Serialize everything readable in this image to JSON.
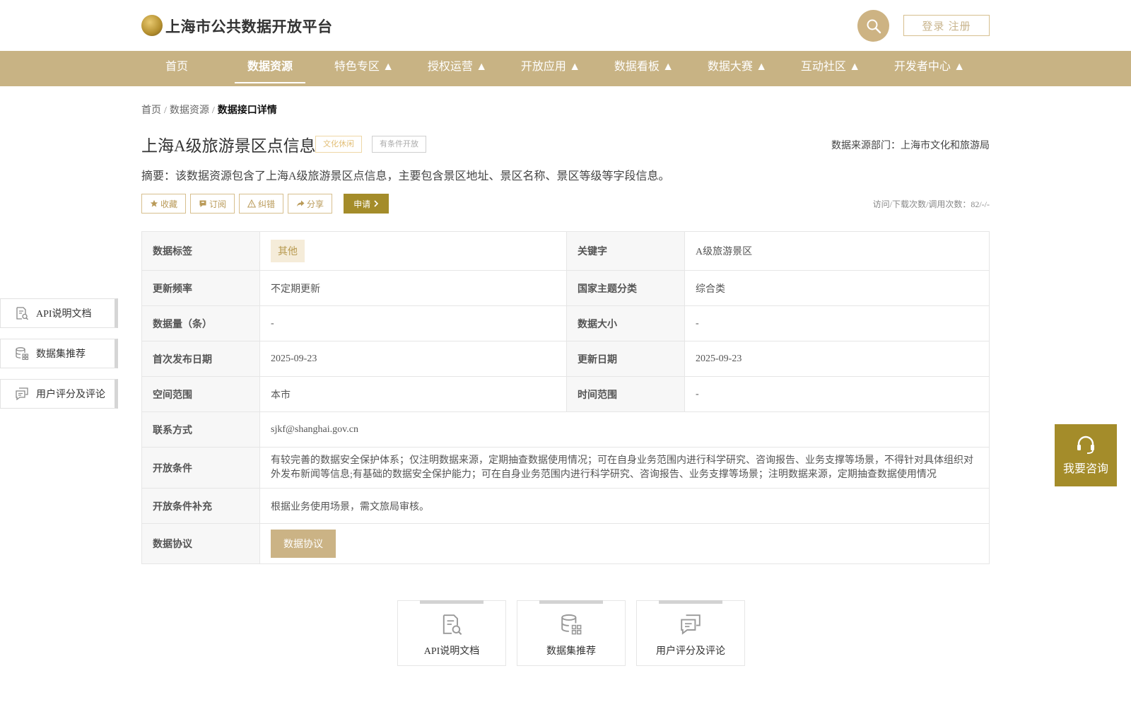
{
  "header": {
    "site_title": "上海市公共数据开放平台",
    "login_label": "登录 注册",
    "logo_icon": "city-seal-logo",
    "search_icon": "search-icon"
  },
  "nav": {
    "items": [
      {
        "label": "首页"
      },
      {
        "label": "数据资源",
        "active": true
      },
      {
        "label": "特色专区 ▲"
      },
      {
        "label": "授权运营 ▲"
      },
      {
        "label": "开放应用 ▲"
      },
      {
        "label": "数据看板 ▲"
      },
      {
        "label": "数据大赛 ▲"
      },
      {
        "label": "互动社区 ▲"
      },
      {
        "label": "开发者中心 ▲"
      }
    ]
  },
  "breadcrumb": {
    "items": [
      "首页",
      "数据资源"
    ],
    "separator": "/",
    "current": "数据接口详情"
  },
  "dataset": {
    "title": "上海A级旅游景区点信息",
    "tags": [
      "文化休闲",
      "有条件开放"
    ],
    "dept": "数据来源部门：上海市文化和旅游局",
    "summary": "摘要：该数据资源包含了上海A级旅游景区点信息，主要包含景区地址、景区名称、景区等级等字段信息。",
    "stats": "访问/下载次数/调用次数：82/-/-"
  },
  "actions": {
    "favorite": "收藏",
    "subscribe": "订阅",
    "report": "纠错",
    "share": "分享",
    "apply": "申请"
  },
  "table": {
    "data_tag_label": "数据标签",
    "data_tag_value": "其他",
    "keyword_label": "关键字",
    "keyword_value": "A级旅游景区",
    "update_freq_label": "更新频率",
    "update_freq_value": "不定期更新",
    "theme_label": "国家主题分类",
    "theme_value": "综合类",
    "count_label": "数据量（条）",
    "count_value": "-",
    "size_label": "数据大小",
    "size_value": "-",
    "first_pub_label": "首次发布日期",
    "first_pub_value": "2025-09-23",
    "update_date_label": "更新日期",
    "update_date_value": "2025-09-23",
    "space_label": "空间范围",
    "space_value": "本市",
    "time_label": "时间范围",
    "time_value": "-",
    "contact_label": "联系方式",
    "contact_value": "sjkf@shanghai.gov.cn",
    "open_cond_label": "开放条件",
    "open_cond_value": "有较完善的数据安全保护体系；仅注明数据来源，定期抽查数据使用情况；可在自身业务范围内进行科学研究、咨询报告、业务支撑等场景，不得针对具体组织对外发布新闻等信息;有基础的数据安全保护能力；可在自身业务范围内进行科学研究、咨询报告、业务支撑等场景；注明数据来源，定期抽查数据使用情况",
    "open_cond_supp_label": "开放条件补充",
    "open_cond_supp_value": "根据业务使用场景，需文旅局审核。",
    "protocol_label": "数据协议",
    "protocol_button": "数据协议"
  },
  "side_panel": {
    "api_doc": "API说明文档",
    "recommend": "数据集推荐",
    "review": "用户评分及评论"
  },
  "consult": {
    "label": "我要咨询"
  },
  "bottom_cards": {
    "api_doc": "API说明文档",
    "recommend": "数据集推荐",
    "review": "用户评分及评论"
  },
  "colors": {
    "brand": "#c8b384",
    "accent": "#a48c2a"
  }
}
